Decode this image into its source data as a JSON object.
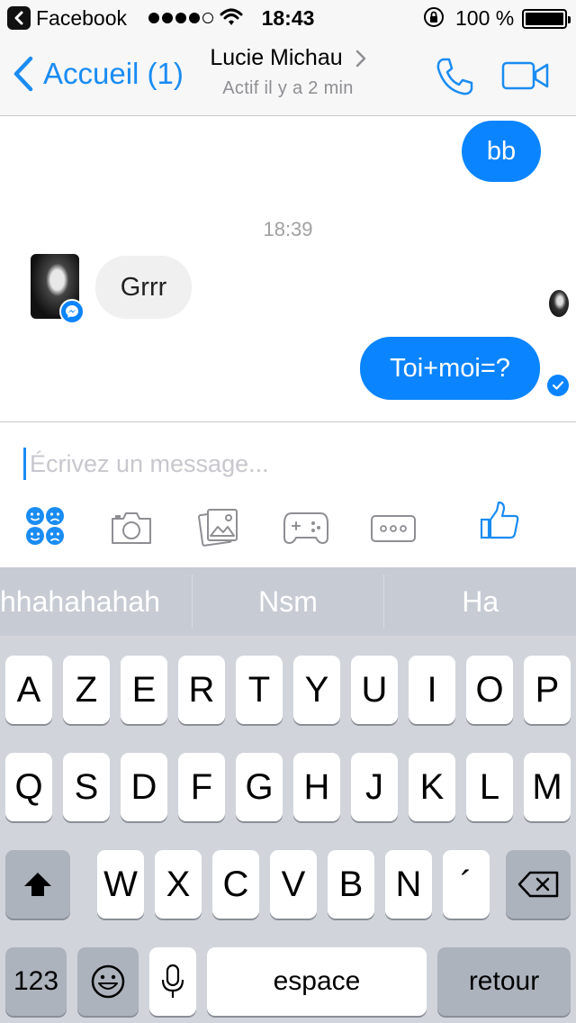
{
  "status_bar": {
    "back_app": "Facebook",
    "time": "18:43",
    "battery_percent": "100 %",
    "signal_bars_filled": 4,
    "signal_bars_total": 5,
    "battery_level": 1.0
  },
  "nav": {
    "back_label": "Accueil (1)",
    "contact_name": "Lucie Michau",
    "status": "Actif il y a 2 min",
    "icons": [
      "chevron-left-icon",
      "chevron-right-icon",
      "phone-icon",
      "video-camera-icon"
    ]
  },
  "messages": [
    {
      "direction": "outgoing",
      "text": "bb"
    },
    {
      "type": "timestamp",
      "text": "18:39"
    },
    {
      "direction": "incoming",
      "text": "Grrr"
    },
    {
      "direction": "outgoing",
      "text": "Toi+moi=?",
      "status": "delivered"
    }
  ],
  "composer": {
    "placeholder": "Écrivez un message...",
    "actions": [
      "emoji-icon",
      "camera-icon",
      "gallery-icon",
      "game-icon",
      "more-icon",
      "like-icon"
    ]
  },
  "predictions": [
    "hhahahahah",
    "Nsm",
    "Ha"
  ],
  "keyboard": {
    "row1": [
      "A",
      "Z",
      "E",
      "R",
      "T",
      "Y",
      "U",
      "I",
      "O",
      "P"
    ],
    "row2": [
      "Q",
      "S",
      "D",
      "F",
      "G",
      "H",
      "J",
      "K",
      "L",
      "M"
    ],
    "row3": [
      "W",
      "X",
      "C",
      "V",
      "B",
      "N",
      "´"
    ],
    "numbers_label": "123",
    "space_label": "espace",
    "return_label": "retour"
  },
  "colors": {
    "accent": "#0b84ff",
    "nav_blue": "#1a8cf2",
    "incoming_bubble": "#f1f0f0",
    "keyboard_bg": "#d1d5db",
    "predict_bg": "#c7cbd4"
  }
}
